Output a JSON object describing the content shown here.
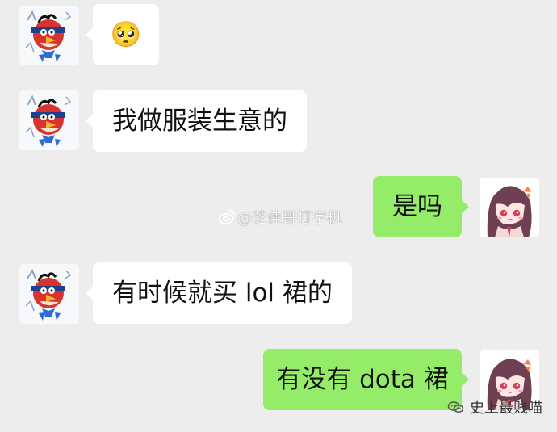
{
  "conversation": {
    "messages": [
      {
        "side": "left",
        "text": "🥺"
      },
      {
        "side": "left",
        "text": "我做服装生意的"
      },
      {
        "side": "right",
        "text": "是吗"
      },
      {
        "side": "left",
        "text": "有时候就买 lol 裙的"
      },
      {
        "side": "right",
        "text": "有没有 dota 裙"
      }
    ]
  },
  "watermark": {
    "weibo_text": "@芝佳哥打字机",
    "channel_text": "史上最贱喵"
  },
  "colors": {
    "background": "#ededed",
    "bubble_left": "#ffffff",
    "bubble_right": "#95ec69"
  }
}
